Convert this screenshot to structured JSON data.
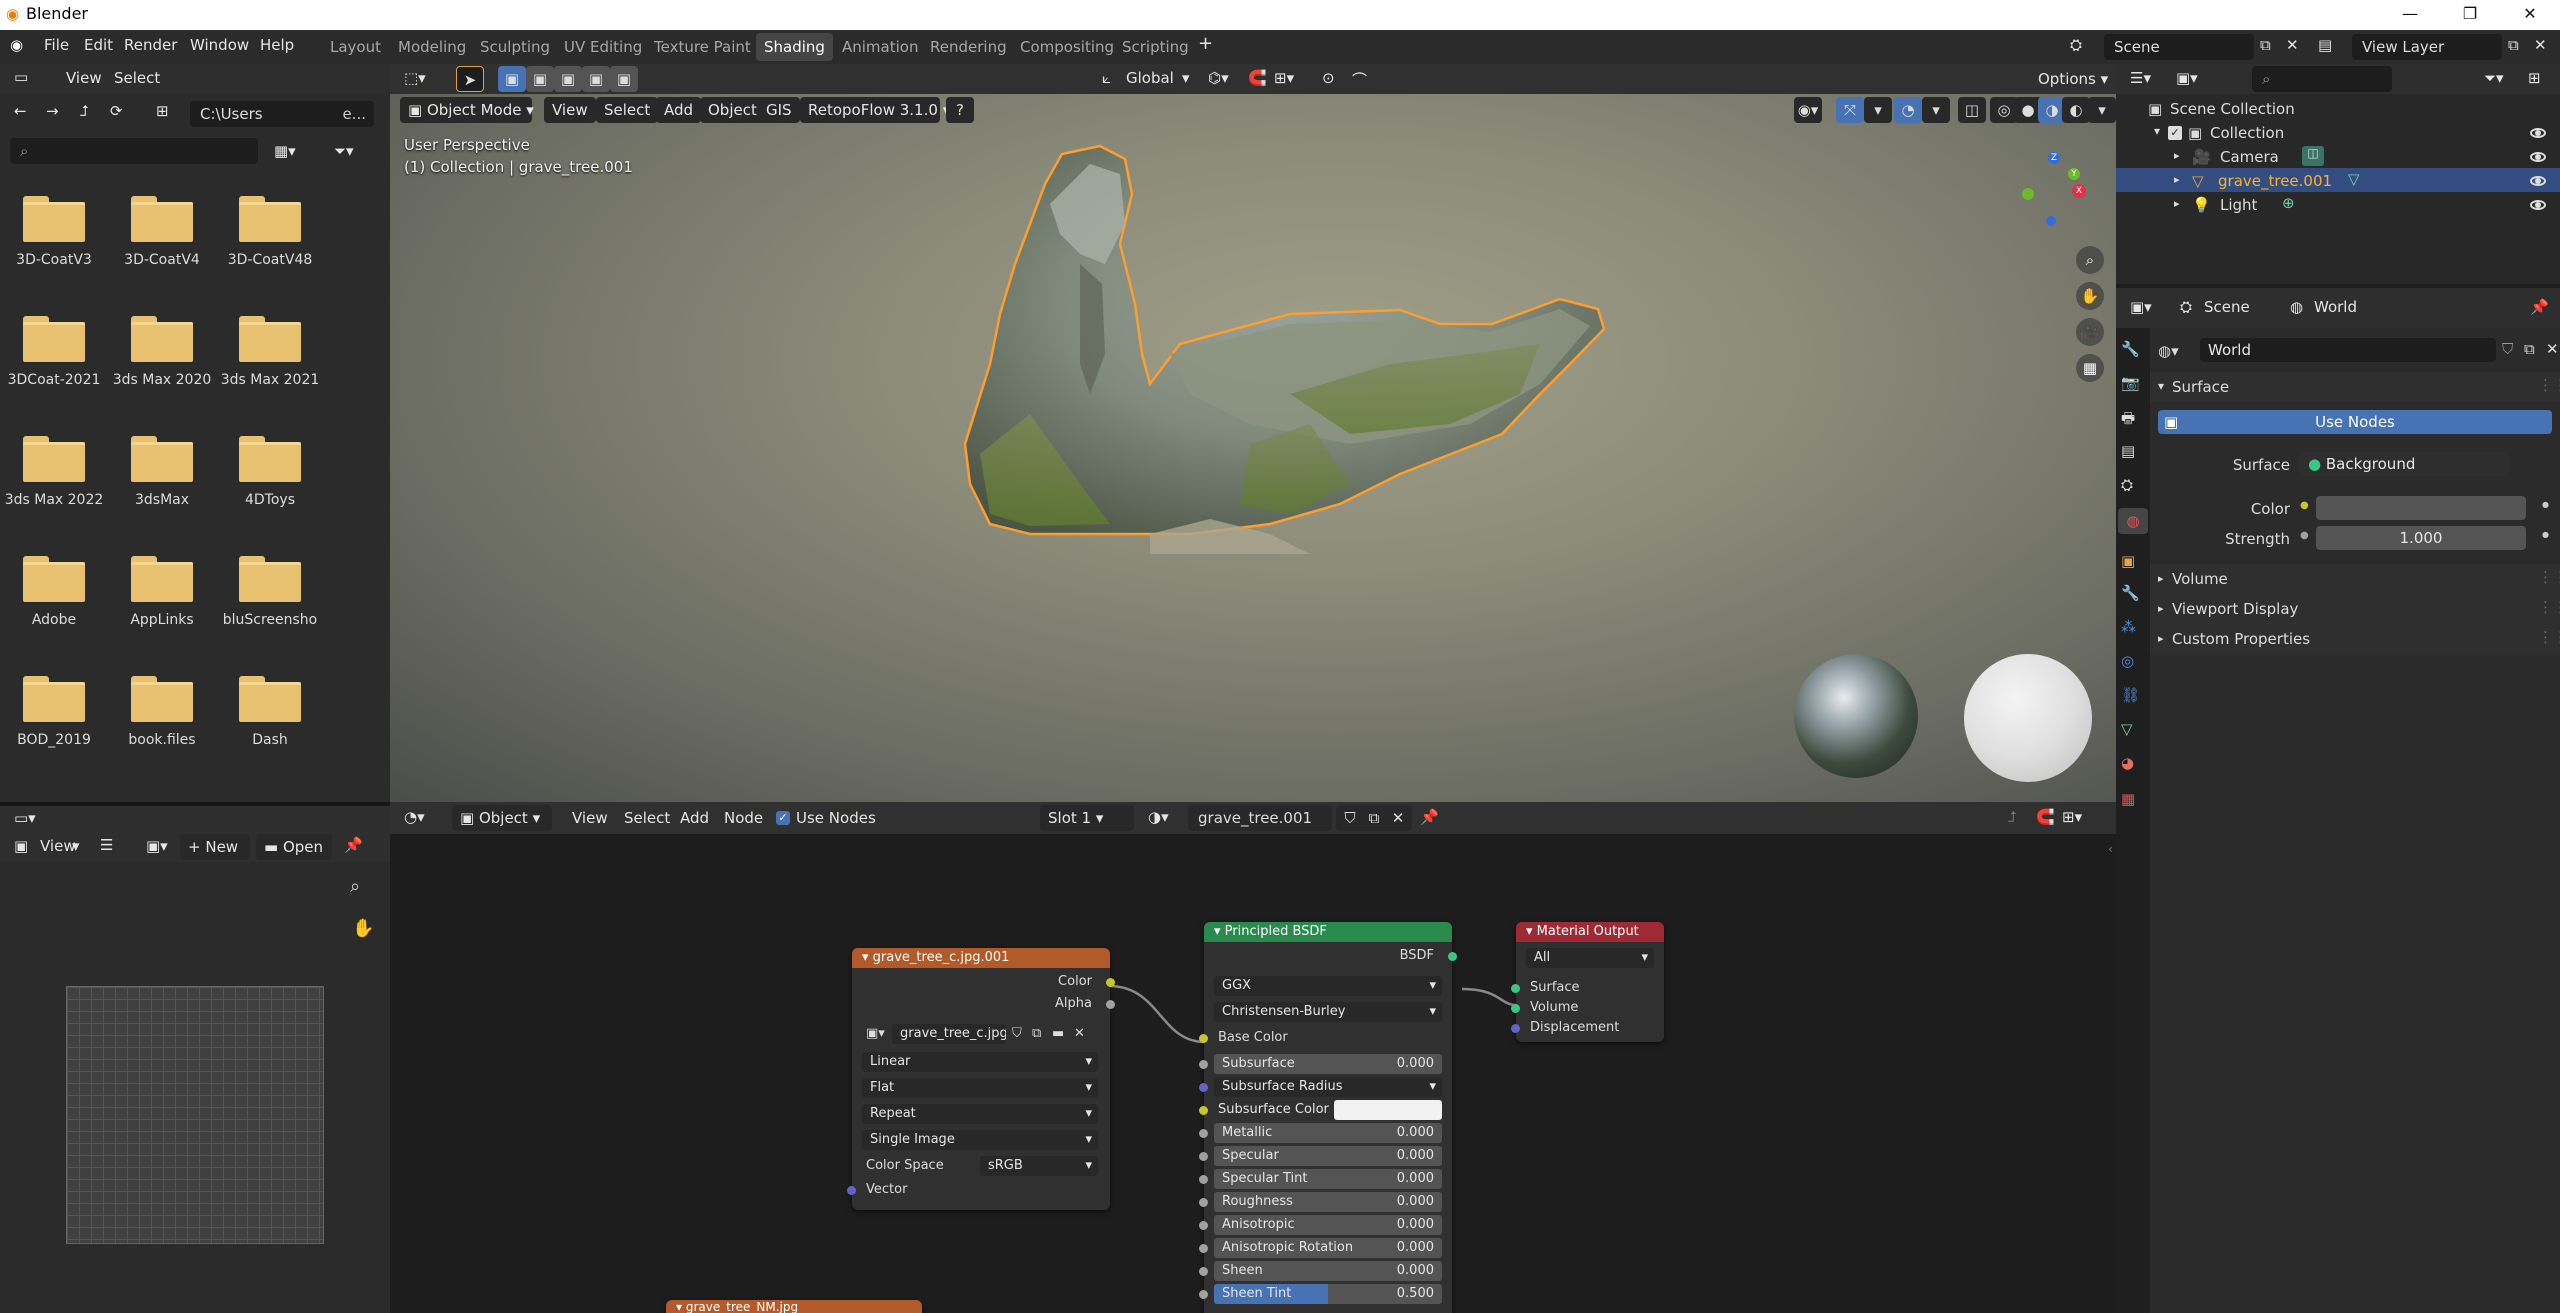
{
  "app": {
    "title": "Blender"
  },
  "menu": [
    "File",
    "Edit",
    "Render",
    "Window",
    "Help"
  ],
  "workspaces": [
    "Layout",
    "Modeling",
    "Sculpting",
    "UV Editing",
    "Texture Paint",
    "Shading",
    "Animation",
    "Rendering",
    "Compositing",
    "Scripting"
  ],
  "active_workspace": "Shading",
  "scene_name": "Scene",
  "view_layer": "View Layer",
  "filebrowser": {
    "menus": [
      "View",
      "Select"
    ],
    "path": "C:\\Users",
    "path_tail": "e...",
    "items": [
      "3D-CoatV3",
      "3D-CoatV4",
      "3D-CoatV48",
      "3DCoat-2021",
      "3ds Max 2020",
      "3ds Max 2021",
      "3ds Max 2022",
      "3dsMax",
      "4DToys",
      "Adobe",
      "AppLinks",
      "bluScreensho",
      "BOD_2019",
      "book.files",
      "Dash"
    ]
  },
  "viewport": {
    "orientation": "Global",
    "options": "Options",
    "mode": "Object Mode",
    "menus": [
      "View",
      "Select",
      "Add",
      "Object",
      "GIS"
    ],
    "addon": "RetopoFlow 3.1.0",
    "perspective": "User Perspective",
    "collection_info": "(1) Collection | grave_tree.001"
  },
  "image_editor": {
    "view": "View",
    "new": "New",
    "open": "Open"
  },
  "node_editor": {
    "type": "Object",
    "menus": [
      "View",
      "Select",
      "Add",
      "Node"
    ],
    "use_nodes": "Use Nodes",
    "slot": "Slot 1",
    "material": "grave_tree.001"
  },
  "nodes": {
    "image": {
      "title": "grave_tree_c.jpg.001",
      "out_color": "Color",
      "out_alpha": "Alpha",
      "image_name": "grave_tree_c.jpg...",
      "interp": "Linear",
      "proj": "Flat",
      "ext": "Repeat",
      "source": "Single Image",
      "cs_label": "Color Space",
      "cs_value": "sRGB",
      "vector": "Vector"
    },
    "bsdf": {
      "title": "Principled BSDF",
      "out": "BSDF",
      "dist": "GGX",
      "sss_method": "Christensen-Burley",
      "base_color": "Base Color",
      "fields": [
        {
          "label": "Subsurface",
          "value": "0.000"
        },
        {
          "label": "Subsurface Radius",
          "value": ""
        },
        {
          "label": "Subsurface Color",
          "value": ""
        },
        {
          "label": "Metallic",
          "value": "0.000"
        },
        {
          "label": "Specular",
          "value": "0.000"
        },
        {
          "label": "Specular Tint",
          "value": "0.000"
        },
        {
          "label": "Roughness",
          "value": "0.000"
        },
        {
          "label": "Anisotropic",
          "value": "0.000"
        },
        {
          "label": "Anisotropic Rotation",
          "value": "0.000"
        },
        {
          "label": "Sheen",
          "value": "0.000"
        },
        {
          "label": "Sheen Tint",
          "value": "0.500"
        }
      ]
    },
    "output": {
      "title": "Material Output",
      "target": "All",
      "surface": "Surface",
      "volume": "Volume",
      "displacement": "Displacement"
    },
    "normal": {
      "title": "grave_tree_NM.jpg"
    }
  },
  "outliner": {
    "root": "Scene Collection",
    "collection": "Collection",
    "items": [
      "Camera",
      "grave_tree.001",
      "Light"
    ]
  },
  "properties": {
    "breadcrumb_scene": "Scene",
    "breadcrumb_world": "World",
    "world_name": "World",
    "surface_panel": "Surface",
    "use_nodes": "Use Nodes",
    "surface_label": "Surface",
    "surface_value": "Background",
    "color_label": "Color",
    "strength_label": "Strength",
    "strength_value": "1.000",
    "panels": [
      "Volume",
      "Viewport Display",
      "Custom Properties"
    ]
  },
  "colors": {
    "accent": "#4772b3",
    "selected_outline": "#ff9d2e",
    "image_node": "#b35a2a",
    "bsdf_node": "#2a8a4d",
    "output_node": "#9e2a35"
  }
}
